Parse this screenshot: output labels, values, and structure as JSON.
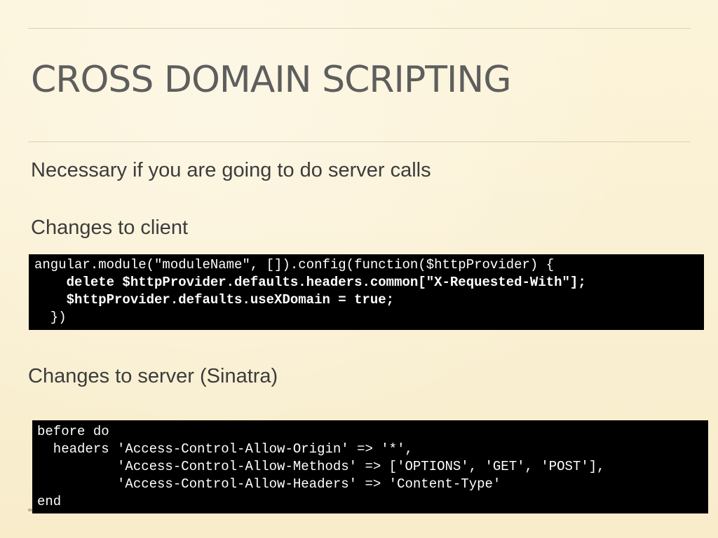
{
  "slide": {
    "title": "CROSS DOMAIN SCRIPTING",
    "bullets": [
      "Necessary if you are going to do server calls",
      "Changes to client",
      "Changes to server (Sinatra)"
    ],
    "client_code": [
      "angular.module(\"moduleName\", []).config(function($httpProvider) {",
      "    delete $httpProvider.defaults.headers.common[\"X-Requested-With\"];",
      "    $httpProvider.defaults.useXDomain = true;",
      "  })"
    ],
    "server_code": [
      "before do",
      "  headers 'Access-Control-Allow-Origin' => '*',",
      "          'Access-Control-Allow-Methods' => ['OPTIONS', 'GET', 'POST'],",
      "          'Access-Control-Allow-Headers' => 'Content-Type'",
      "end"
    ]
  },
  "colors": {
    "background": "#fbf3d7",
    "title": "#5e5e5e",
    "text": "#3c3c3c",
    "code_background": "#000000",
    "code_text": "#ffffff"
  }
}
